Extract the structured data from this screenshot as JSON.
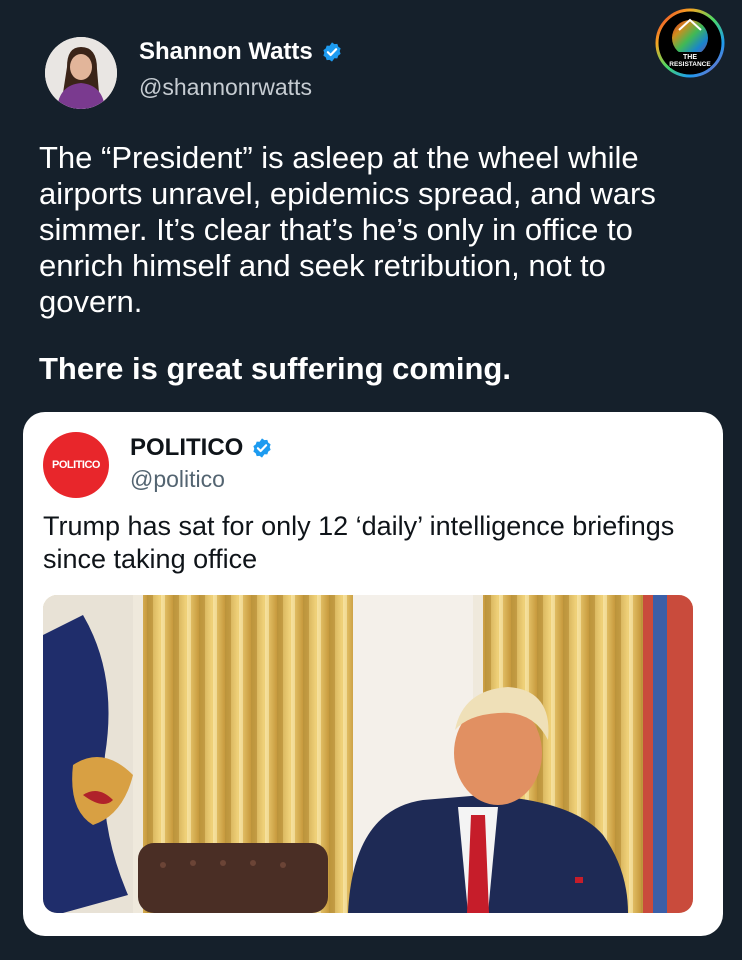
{
  "author": {
    "display_name": "Shannon Watts",
    "handle": "@shannonrwatts",
    "verified_icon": "verified-badge-icon",
    "avatar_icon": "avatar-photo"
  },
  "watermark": {
    "icon": "the-resistance-logo",
    "text": "THE RESISTANCE"
  },
  "tweet": {
    "body": "The “President” is asleep at the wheel while airports unravel, epidemics spread, and wars simmer. It’s clear that’s he’s only in office to enrich himself and seek retribution, not to govern.",
    "emphasis": "There is great suffering coming."
  },
  "quoted": {
    "display_name": "POLITICO",
    "handle": "@politico",
    "avatar_text": "POLITICO",
    "verified_icon": "verified-badge-icon",
    "body": "Trump has sat for only 12 ‘daily’ intelligence briefings since taking office",
    "photo_icon": "news-photo"
  },
  "colors": {
    "background": "#15202b",
    "verified": "#1d9bf0",
    "politico_red": "#e8262b",
    "card_bg": "#ffffff"
  }
}
